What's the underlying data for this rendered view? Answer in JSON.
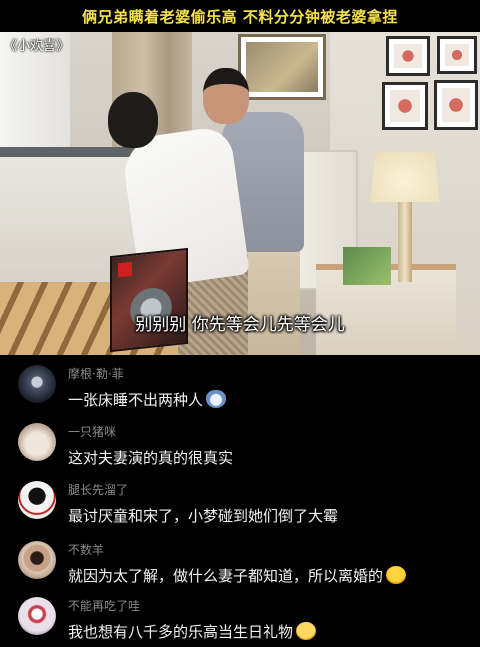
{
  "banner": {
    "text": "俩兄弟瞒着老婆偷乐高 不料分分钟被老婆拿捏"
  },
  "video": {
    "watermark": "《小欢喜》",
    "subtitle": "别别别 你先等会儿先等会儿"
  },
  "comments": [
    {
      "username": "摩根·勒·菲",
      "text": "一张床睡不出两种人",
      "emoji": "cat-icon"
    },
    {
      "username": "一只猪咪",
      "text": "这对夫妻演的真的很真实",
      "emoji": ""
    },
    {
      "username": "腿长先溜了",
      "text": "最讨厌童和宋了，小梦碰到她们倒了大霉",
      "emoji": ""
    },
    {
      "username": "不数羊",
      "text": "就因为太了解，做什么妻子都知道，所以离婚的",
      "emoji": "laugh-cry-icon"
    },
    {
      "username": "不能再吃了哇",
      "text": "我也想有八千多的乐高当生日礼物",
      "emoji": "flushed-face-icon"
    }
  ],
  "colors": {
    "banner_text": "#f5e24a",
    "username": "#8a8a8a",
    "comment_text": "#f2f2f2"
  }
}
